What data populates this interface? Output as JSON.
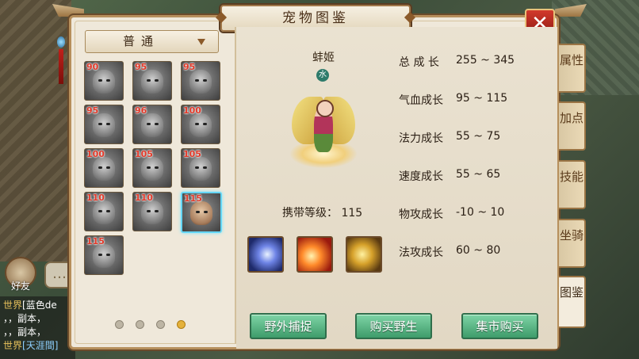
{
  "window": {
    "title": "宠物图鉴"
  },
  "filter": {
    "selected": "普通"
  },
  "pets": [
    {
      "level": "90",
      "selected": false
    },
    {
      "level": "95",
      "selected": false
    },
    {
      "level": "95",
      "selected": false
    },
    {
      "level": "95",
      "selected": false
    },
    {
      "level": "96",
      "selected": false
    },
    {
      "level": "100",
      "selected": false
    },
    {
      "level": "100",
      "selected": false
    },
    {
      "level": "105",
      "selected": false
    },
    {
      "level": "105",
      "selected": false
    },
    {
      "level": "110",
      "selected": false
    },
    {
      "level": "110",
      "selected": false
    },
    {
      "level": "115",
      "selected": true
    },
    {
      "level": "115",
      "selected": false
    }
  ],
  "pagination": {
    "pages": 4,
    "current": 4
  },
  "detail": {
    "name": "蚌姬",
    "element": "水",
    "carry_level_label": "携带等级：",
    "carry_level": "115",
    "skills": [
      "skill-icon-1",
      "skill-icon-2",
      "skill-icon-3"
    ]
  },
  "stats": [
    {
      "label": "总 成 长",
      "value": "255 ~ 345"
    },
    {
      "label": "气血成长",
      "value": "95 ~ 115"
    },
    {
      "label": "法力成长",
      "value": "55 ~ 75"
    },
    {
      "label": "速度成长",
      "value": "55 ~ 65"
    },
    {
      "label": "物攻成长",
      "value": "-10 ~ 10"
    },
    {
      "label": "法攻成长",
      "value": "60 ~ 80"
    }
  ],
  "actions": {
    "wild_capture": "野外捕捉",
    "buy_wild": "购买野生",
    "market_buy": "集市购买"
  },
  "side_tabs": [
    {
      "label": "属性",
      "active": false
    },
    {
      "label": "加点",
      "active": false
    },
    {
      "label": "技能",
      "active": false
    },
    {
      "label": "坐骑",
      "active": false
    },
    {
      "label": "图鉴",
      "active": true
    }
  ],
  "chat": {
    "friend_label": "好友",
    "lines": [
      {
        "tag": "世界",
        "text": "[蓝色de"
      },
      {
        "tag": "",
        "text": "，，副本，"
      },
      {
        "tag": "",
        "text": "，，副本，"
      },
      {
        "tag": "世界",
        "text": "[天涯間]"
      }
    ]
  },
  "colors": {
    "accent": "#b68f5c",
    "button": "#4fae7c",
    "close": "#c2281e",
    "level_text": "#e23a2a"
  }
}
